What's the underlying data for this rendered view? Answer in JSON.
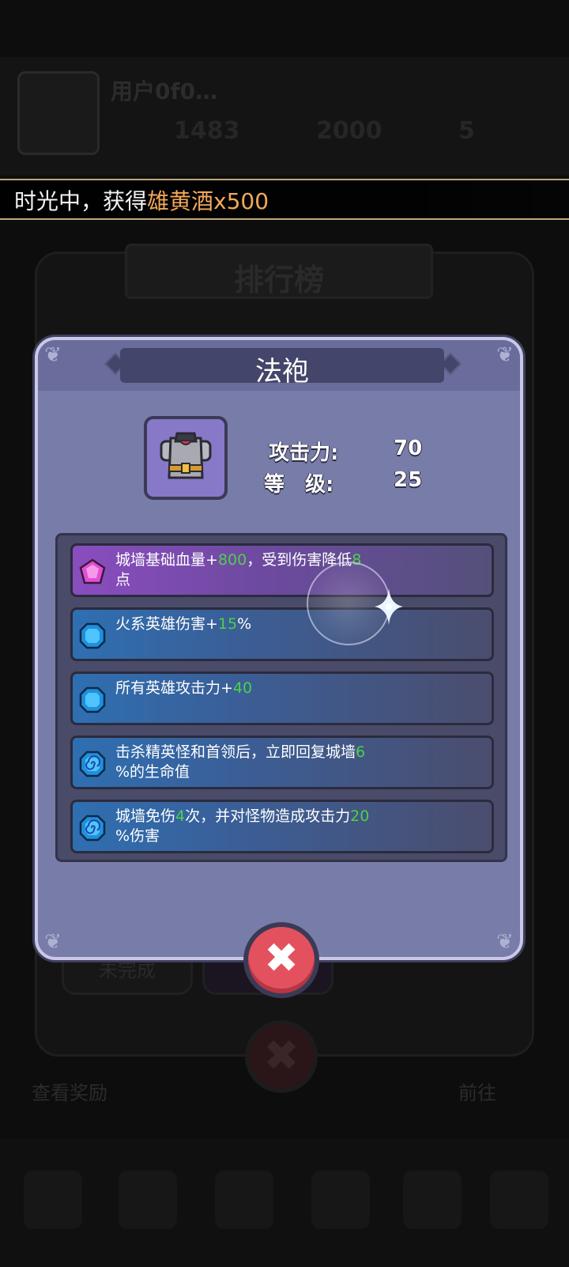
{
  "background": {
    "player_name": "用户0f0…",
    "stats": [
      "1483",
      "2000",
      "5"
    ],
    "leaderboard_title": "排行榜",
    "tabs": [
      "未完成",
      ""
    ],
    "bottom_left_label": "查看奖励",
    "bottom_right_label": "前往"
  },
  "banner": {
    "prefix": "时光中，获得",
    "highlight": "雄黄酒x500"
  },
  "dialog": {
    "title": "法袍",
    "item_icon": "robe-armor-icon",
    "stats": [
      {
        "label": "攻击力:",
        "value": "70"
      },
      {
        "label": "等　级:",
        "value": "25"
      }
    ],
    "attributes": [
      {
        "tier": "purple",
        "icon": "pink-gem-icon",
        "parts": [
          "城墙基础血量+",
          "800",
          "，受到伤害降低",
          "8",
          "点"
        ]
      },
      {
        "tier": "blue",
        "icon": "blue-gem-icon",
        "parts": [
          "火系英雄伤害+",
          "15",
          "%"
        ]
      },
      {
        "tier": "blue",
        "icon": "blue-gem-icon",
        "parts": [
          "所有英雄攻击力+",
          "40"
        ]
      },
      {
        "tier": "blue",
        "icon": "swirl-gem-icon",
        "parts": [
          "击杀精英怪和首领后，立即回复城墙",
          "6",
          "%的生命值"
        ]
      },
      {
        "tier": "blue",
        "icon": "swirl-gem-icon",
        "parts": [
          "城墙免伤",
          "4",
          "次，并对怪物造成攻击力",
          "20",
          "%伤害"
        ]
      }
    ],
    "close_icon": "close-icon"
  },
  "colors": {
    "dialog_bg": "#787ca8",
    "highlight_green": "#4cd04c",
    "banner_highlight": "#f2a85a",
    "close_button": "#e4515e"
  }
}
